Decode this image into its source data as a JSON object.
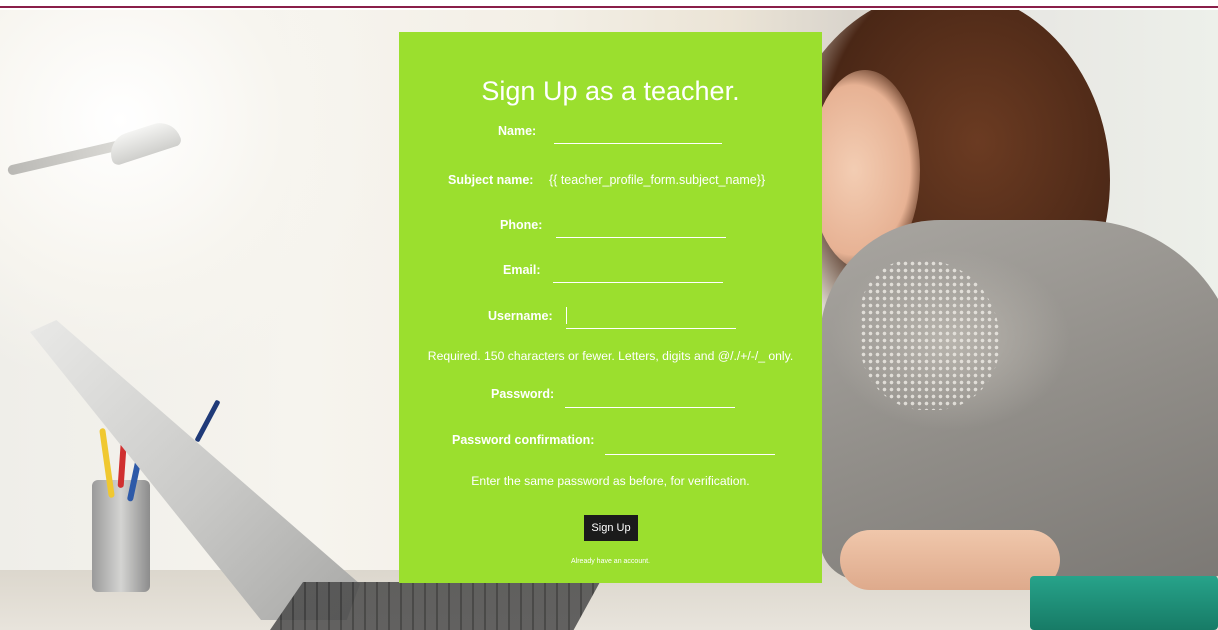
{
  "form": {
    "title": "Sign Up as a teacher.",
    "fields": {
      "name": {
        "label": "Name:"
      },
      "subject": {
        "label": "Subject name:",
        "value": "{{ teacher_profile_form.subject_name}}"
      },
      "phone": {
        "label": "Phone:"
      },
      "email": {
        "label": "Email:"
      },
      "username": {
        "label": "Username:",
        "help": "Required. 150 characters or fewer. Letters, digits and @/./+/-/_ only."
      },
      "password": {
        "label": "Password:"
      },
      "password_confirm": {
        "label": "Password confirmation:",
        "help": "Enter the same password as before, for verification."
      }
    },
    "submit_label": "Sign Up",
    "login_link": "Already have an account."
  },
  "colors": {
    "panel": "#9bdf2e",
    "button": "#1b1b1b",
    "top_rule": "#8a1f4a"
  }
}
